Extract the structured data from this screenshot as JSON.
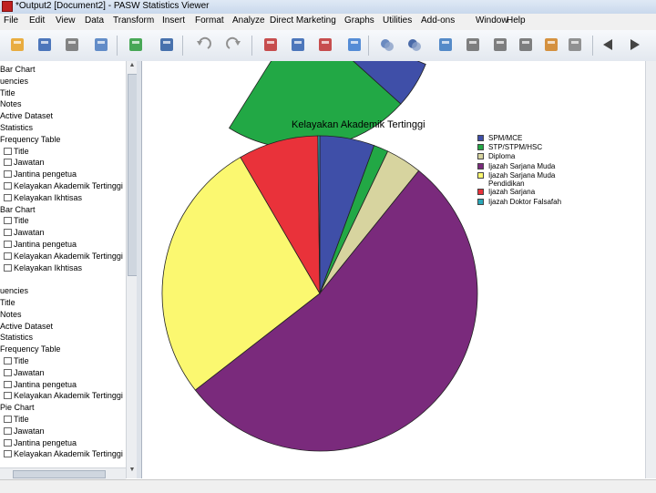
{
  "window": {
    "title": "*Output2 [Document2] - PASW Statistics Viewer"
  },
  "menu": [
    "File",
    "Edit",
    "View",
    "Data",
    "Transform",
    "Insert",
    "Format",
    "Analyze",
    "Direct Marketing",
    "Graphs",
    "Utilities",
    "Add-ons",
    "Window",
    "Help"
  ],
  "toolbar": {
    "icons": [
      "open-icon",
      "save-icon",
      "print-icon",
      "print-preview-icon",
      "export-icon",
      "recall-dialog-icon",
      "undo-icon",
      "redo-icon",
      "goto-data-icon",
      "goto-case-icon",
      "insert-output-icon",
      "variables-icon",
      "show-icon",
      "hide-icon",
      "promote-icon",
      "demote-icon",
      "collapse-icon",
      "expand-icon",
      "insert-heading-icon",
      "insert-title-icon",
      "back-arrow-icon",
      "forward-arrow-icon"
    ]
  },
  "outline": {
    "items": [
      {
        "text": "Bar Chart",
        "icon": false,
        "indent": 0
      },
      {
        "text": "uencies",
        "icon": false,
        "indent": 0
      },
      {
        "text": "Title",
        "icon": false,
        "indent": 0
      },
      {
        "text": "Notes",
        "icon": false,
        "indent": 0
      },
      {
        "text": "Active Dataset",
        "icon": false,
        "indent": 0
      },
      {
        "text": "Statistics",
        "icon": false,
        "indent": 0
      },
      {
        "text": "Frequency Table",
        "icon": false,
        "indent": 0
      },
      {
        "text": "Title",
        "icon": true,
        "indent": 4
      },
      {
        "text": "Jawatan",
        "icon": true,
        "indent": 4
      },
      {
        "text": "Jantina pengetua",
        "icon": true,
        "indent": 4
      },
      {
        "text": "Kelayakan Akademik Tertinggi",
        "icon": true,
        "indent": 4
      },
      {
        "text": "Kelayakan Ikhtisas",
        "icon": true,
        "indent": 4
      },
      {
        "text": "Bar Chart",
        "icon": false,
        "indent": 0
      },
      {
        "text": "Title",
        "icon": true,
        "indent": 4
      },
      {
        "text": "Jawatan",
        "icon": true,
        "indent": 4
      },
      {
        "text": "Jantina pengetua",
        "icon": true,
        "indent": 4
      },
      {
        "text": "Kelayakan Akademik Tertinggi",
        "icon": true,
        "indent": 4
      },
      {
        "text": "Kelayakan Ikhtisas",
        "icon": true,
        "indent": 4
      },
      {
        "text": "",
        "icon": false,
        "indent": 0
      },
      {
        "text": "uencies",
        "icon": false,
        "indent": 0
      },
      {
        "text": "Title",
        "icon": false,
        "indent": 0
      },
      {
        "text": "Notes",
        "icon": false,
        "indent": 0
      },
      {
        "text": "Active Dataset",
        "icon": false,
        "indent": 0
      },
      {
        "text": "Statistics",
        "icon": false,
        "indent": 0
      },
      {
        "text": "Frequency Table",
        "icon": false,
        "indent": 0
      },
      {
        "text": "Title",
        "icon": true,
        "indent": 4
      },
      {
        "text": "Jawatan",
        "icon": true,
        "indent": 4
      },
      {
        "text": "Jantina pengetua",
        "icon": true,
        "indent": 4
      },
      {
        "text": "Kelayakan Akademik Tertinggi",
        "icon": true,
        "indent": 4
      },
      {
        "text": "Pie Chart",
        "icon": false,
        "indent": 0
      },
      {
        "text": "Title",
        "icon": true,
        "indent": 4
      },
      {
        "text": "Jawatan",
        "icon": true,
        "indent": 4
      },
      {
        "text": "Jantina pengetua",
        "icon": true,
        "indent": 4
      },
      {
        "text": "Kelayakan Akademik Tertinggi",
        "icon": true,
        "indent": 4
      }
    ]
  },
  "chart_data": {
    "type": "pie",
    "title": "Kelayakan Akademik Tertinggi",
    "categories": [
      "SPM/MCE",
      "STP/STPM/HSC",
      "Diploma",
      "Ijazah Sarjana Muda",
      "Ijazah Sarjana Muda Pendidikan",
      "Ijazah Sarjana",
      "Ijazah Doktor Falsafah"
    ],
    "values": [
      5.6,
      1.5,
      3.7,
      53.7,
      27.1,
      8.2,
      0.2
    ],
    "colors": [
      "#3f4fa8",
      "#22a845",
      "#d7d49f",
      "#7a2a7c",
      "#fbf870",
      "#e9323a",
      "#2aa7b8"
    ],
    "legend": "right",
    "previous_chart_colors": [
      "#22a845",
      "#3f4fa8"
    ]
  }
}
